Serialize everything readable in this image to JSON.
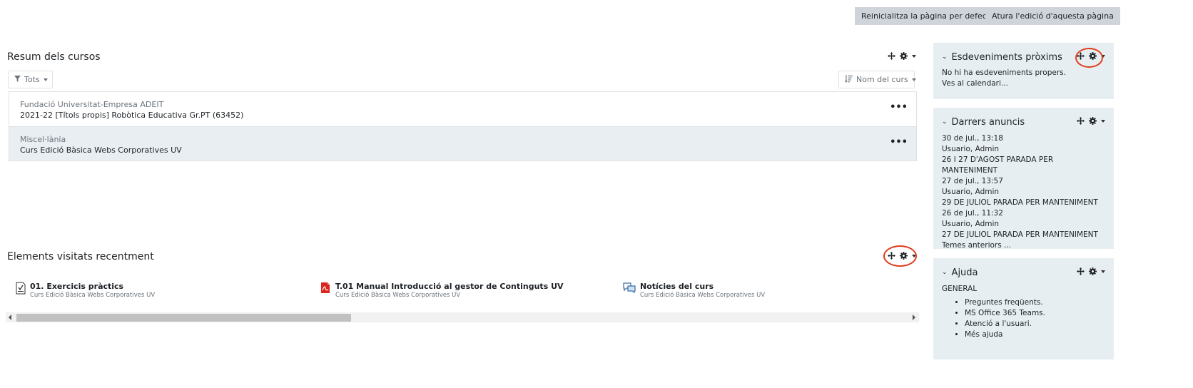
{
  "top_buttons": {
    "reset": "Reinicialitza la pàgina per defecte",
    "stop_editing": "Atura l'edició d'aquesta pàgina"
  },
  "course_overview": {
    "title": "Resum dels cursos",
    "filter_label": "Tots",
    "sort_label": "Nom del curs",
    "courses": [
      {
        "category": "Fundació Universitat-Empresa ADEIT",
        "name": "2021-22 [Títols propis] Robòtica Educativa Gr.PT (63452)",
        "menu": "•••"
      },
      {
        "category": "Miscel·lània",
        "name": "Curs Edició Bàsica Webs Corporatives UV",
        "menu": "•••"
      }
    ]
  },
  "recent_items": {
    "title": "Elements visitats recentment",
    "items": [
      {
        "name": "01. Exercicis pràctics",
        "course": "Curs Edició Bàsica Webs Corporatives UV",
        "icon": "quiz-icon"
      },
      {
        "name": "T.01 Manual Introducció al gestor de Continguts UV",
        "course": "Curs Edició Bàsica Webs Corporatives UV",
        "icon": "pdf-icon"
      },
      {
        "name": "Notícies del curs",
        "course": "Curs Edició Bàsica Webs Corporatives UV",
        "icon": "forum-icon"
      }
    ]
  },
  "upcoming_events": {
    "title": "Esdeveniments pròxims",
    "no_events": "No hi ha esdeveniments propers.",
    "calendar_link": "Ves al calendari..."
  },
  "latest_announcements": {
    "title": "Darrers anuncis",
    "posts": [
      {
        "date": "30 de jul., 13:18",
        "author": "Usuario, Admin",
        "subject": "26 I 27 D'AGOST PARADA PER MANTENIMENT"
      },
      {
        "date": "27 de jul., 13:57",
        "author": "Usuario, Admin",
        "subject": "29 DE JULIOL PARADA PER MANTENIMENT"
      },
      {
        "date": "26 de jul., 11:32",
        "author": "Usuario, Admin",
        "subject": "27 DE JULIOL PARADA PER MANTENIMENT"
      }
    ],
    "older_link": "Temes anteriors ..."
  },
  "help": {
    "title": "Ajuda",
    "section": "GENERAL",
    "links": [
      "Preguntes freqüents.",
      "MS Office 365 Teams.",
      "Atenció a l'usuari.",
      "Més ajuda"
    ]
  },
  "colors": {
    "block_bg": "#e7eef2",
    "button_bg": "#ced4da",
    "highlight_circle": "#e33b1a"
  }
}
